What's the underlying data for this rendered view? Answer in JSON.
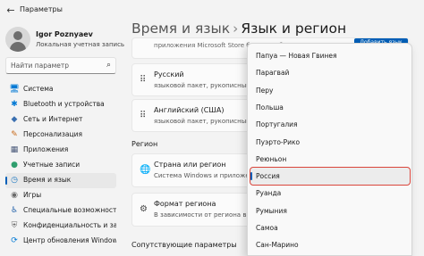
{
  "window": {
    "title": "Параметры",
    "back_glyph": "←"
  },
  "profile": {
    "name": "Igor Poznyaev",
    "account_type": "Локальная учетная запись"
  },
  "search": {
    "placeholder": "Найти параметр",
    "icon": "⌕"
  },
  "sidebar": {
    "items": [
      {
        "label": "Система",
        "icon": "🖥",
        "color": "#0078d4"
      },
      {
        "label": "Bluetooth и устройства",
        "icon": "✱",
        "color": "#0078d4"
      },
      {
        "label": "Сеть и Интернет",
        "icon": "◆",
        "color": "#3a6fb0"
      },
      {
        "label": "Персонализация",
        "icon": "✎",
        "color": "#c86a1a"
      },
      {
        "label": "Приложения",
        "icon": "▦",
        "color": "#4a5a7a"
      },
      {
        "label": "Учетные записи",
        "icon": "●",
        "color": "#2f9e6e"
      },
      {
        "label": "Время и язык",
        "icon": "◷",
        "color": "#1f7ac2",
        "active": true
      },
      {
        "label": "Игры",
        "icon": "◉",
        "color": "#6b6b6b"
      },
      {
        "label": "Специальные возможности",
        "icon": "♿",
        "color": "#1f5fa8"
      },
      {
        "label": "Конфиденциальность и защита",
        "icon": "⛨",
        "color": "#6b6b6b"
      },
      {
        "label": "Центр обновления Windows",
        "icon": "⟳",
        "color": "#0078d4"
      }
    ]
  },
  "header": {
    "breadcrumb_parent": "Время и язык",
    "separator": "›",
    "breadcrumb_current": "Язык и регион"
  },
  "main": {
    "store_note": "приложения Microsoft Store будут отображаться на",
    "install_button": "Добавить язык",
    "languages": [
      {
        "title": "Русский",
        "subtitle": "языковой пакет, рукописный ввод",
        "icon": "⠿"
      },
      {
        "title": "Английский (США)",
        "subtitle": "языковой пакет, рукописный ввод",
        "icon": "⠿"
      }
    ],
    "region_section": "Регион",
    "region_rows": [
      {
        "title": "Страна или регион",
        "subtitle": "Система Windows и приложения могут использовать",
        "icon": "🌐"
      },
      {
        "title": "Формат региона",
        "subtitle": "В зависимости от региона в Windows",
        "icon": "⚙"
      }
    ],
    "advanced_section": "Сопутствующие параметры"
  },
  "dropdown": {
    "items": [
      "Папуа — Новая Гвинея",
      "Парагвай",
      "Перу",
      "Польша",
      "Португалия",
      "Пуэрто-Рико",
      "Реюньон",
      "Россия",
      "Руанда",
      "Румыния",
      "Самоа",
      "Сан-Марино"
    ],
    "selected": "Россия"
  }
}
